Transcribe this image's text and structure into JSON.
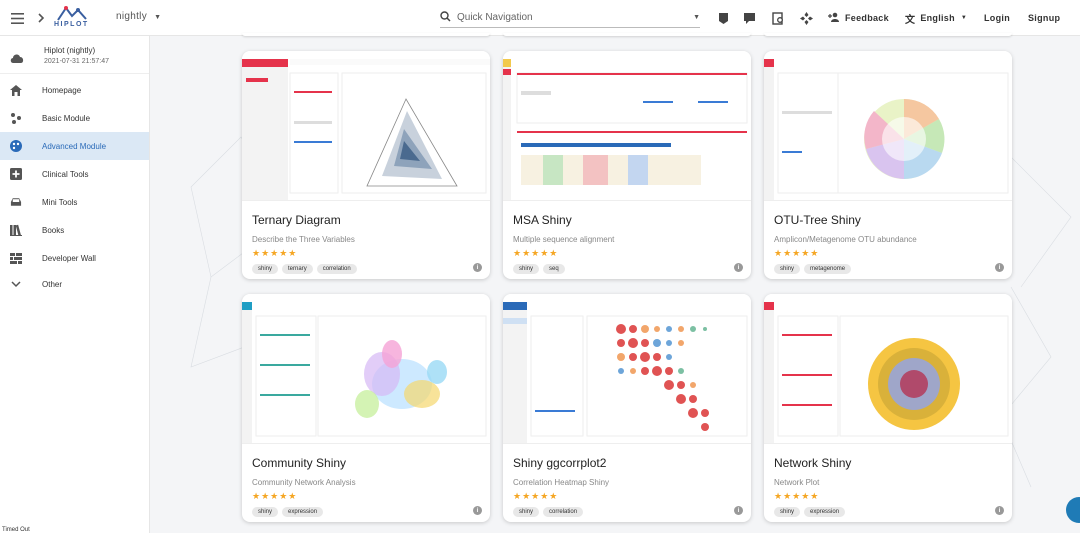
{
  "header": {
    "logo_text": "HIPLOT",
    "version": "nightly",
    "search_placeholder": "Quick Navigation",
    "feedback": "Feedback",
    "language": "English",
    "login": "Login",
    "signup": "Signup"
  },
  "sidebar": {
    "app_name": "Hiplot (nightly)",
    "timestamp": "2021-07-31 21:57:47",
    "items": [
      {
        "label": "Homepage",
        "icon": "home-icon"
      },
      {
        "label": "Basic Module",
        "icon": "dots-icon"
      },
      {
        "label": "Advanced Module",
        "icon": "palette-icon"
      },
      {
        "label": "Clinical Tools",
        "icon": "plus-box-icon"
      },
      {
        "label": "Mini Tools",
        "icon": "car-icon"
      },
      {
        "label": "Books",
        "icon": "books-icon"
      },
      {
        "label": "Developer Wall",
        "icon": "grid-icon"
      },
      {
        "label": "Other",
        "icon": "chevron-down-icon"
      }
    ],
    "active": "Advanced Module",
    "status": "Timed Out"
  },
  "cards": [
    {
      "title": "Ternary Diagram",
      "desc": "Describe the Three Variables",
      "stars": "★★★★★",
      "tags": [
        "shiny",
        "ternary",
        "correlation"
      ]
    },
    {
      "title": "MSA Shiny",
      "desc": "Multiple sequence alignment",
      "stars": "★★★★★",
      "tags": [
        "shiny",
        "seq"
      ]
    },
    {
      "title": "OTU-Tree Shiny",
      "desc": "Amplicon/Metagenome OTU abundance",
      "stars": "★★★★★",
      "tags": [
        "shiny",
        "metagenome"
      ]
    },
    {
      "title": "Community Shiny",
      "desc": "Community Network Analysis",
      "stars": "★★★★★",
      "tags": [
        "shiny",
        "expression"
      ]
    },
    {
      "title": "Shiny ggcorrplot2",
      "desc": "Correlation Heatmap Shiny",
      "stars": "★★★★★",
      "tags": [
        "shiny",
        "correlation"
      ]
    },
    {
      "title": "Network Shiny",
      "desc": "Network Plot",
      "stars": "★★★★★",
      "tags": [
        "shiny",
        "expression"
      ]
    }
  ],
  "colors": {
    "accent": "#2a6ab8",
    "active_bg": "#dbe8f5",
    "star": "#f5a623",
    "brand_red": "#e5334b"
  }
}
